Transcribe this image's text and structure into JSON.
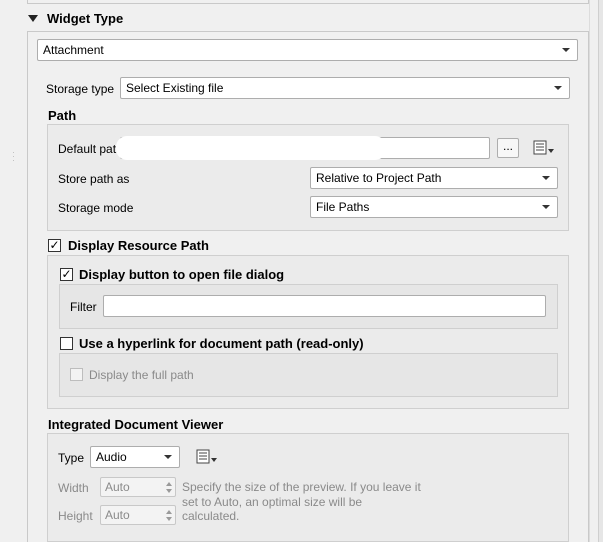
{
  "widget_type": {
    "section_title": "Widget Type",
    "selected_widget": "Attachment"
  },
  "storage_type": {
    "label": "Storage type",
    "value": "Select Existing file"
  },
  "path": {
    "group_title": "Path",
    "default_path_label": "Default path",
    "browse_button_label": "...",
    "store_path_label": "Store path as",
    "store_path_value": "Relative to Project Path",
    "storage_mode_label": "Storage mode",
    "storage_mode_value": "File Paths"
  },
  "display_resource_path": {
    "label": "Display Resource Path",
    "checked": true,
    "open_file_dialog": {
      "label": "Display button to open file dialog",
      "checked": true,
      "filter_label": "Filter",
      "filter_value": ""
    },
    "hyperlink": {
      "label": "Use a hyperlink for document path (read-only)",
      "checked": false,
      "full_path_label": "Display the full path",
      "full_path_checked": false
    }
  },
  "viewer": {
    "group_title": "Integrated Document Viewer",
    "type_label": "Type",
    "type_value": "Audio",
    "width_label": "Width",
    "width_value": "Auto",
    "height_label": "Height",
    "height_value": "Auto",
    "hint": "Specify the size of the preview. If you leave it set to Auto, an optimal size will be calculated."
  },
  "icons": {
    "collapse": "triangle-down-icon",
    "expression": "expression-menu-icon",
    "check": "✓"
  },
  "colors": {
    "panel_bg": "#f0f0f0",
    "input_bg": "#ffffff",
    "border": "#adadad",
    "disabled_text": "#8a8a8a"
  }
}
